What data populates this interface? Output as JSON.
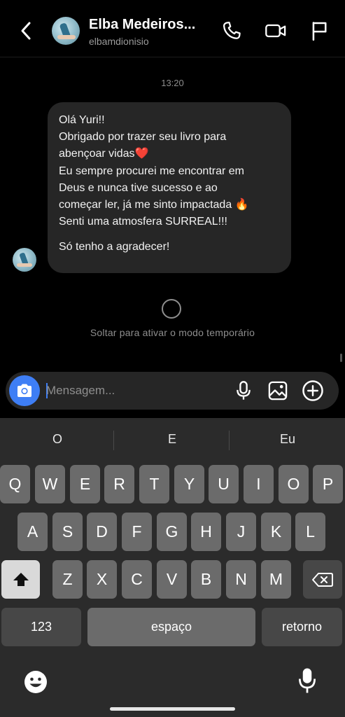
{
  "header": {
    "name": "Elba Medeiros...",
    "username": "elbamdionisio"
  },
  "chat": {
    "timestamp": "13:20",
    "message_lines": [
      "Olá Yuri!!",
      "Obrigado por trazer seu livro para",
      "abençoar vidas❤️",
      "Eu sempre procurei me encontrar em",
      "Deus e nunca tive sucesso e ao",
      "começar ler, já me sinto impactada 🔥",
      "Senti uma atmosfera SURREAL!!!",
      "Só tenho a agradecer!"
    ],
    "temporary_mode_text": "Soltar para ativar o modo temporário"
  },
  "composer": {
    "placeholder": "Mensagem..."
  },
  "keyboard": {
    "suggestions": [
      "O",
      "E",
      "Eu"
    ],
    "row1": [
      "Q",
      "W",
      "E",
      "R",
      "T",
      "Y",
      "U",
      "I",
      "O",
      "P"
    ],
    "row2": [
      "A",
      "S",
      "D",
      "F",
      "G",
      "H",
      "J",
      "K",
      "L"
    ],
    "row3": [
      "Z",
      "X",
      "C",
      "V",
      "B",
      "N",
      "M"
    ],
    "numbers_label": "123",
    "space_label": "espaço",
    "return_label": "retorno"
  },
  "icons": {
    "back": "chevron-left-icon",
    "call": "phone-icon",
    "video": "video-camera-icon",
    "report": "flag-icon",
    "camera": "camera-icon",
    "mic": "microphone-icon",
    "gallery": "image-icon",
    "add": "plus-circle-icon",
    "shift": "shift-arrow-icon",
    "delete": "backspace-icon",
    "emoji": "emoji-icon",
    "dictation": "microphone-icon"
  },
  "colors": {
    "background": "#000000",
    "bubble": "#262626",
    "accent": "#3e7ef5",
    "muted_text": "#8e8e8e"
  }
}
